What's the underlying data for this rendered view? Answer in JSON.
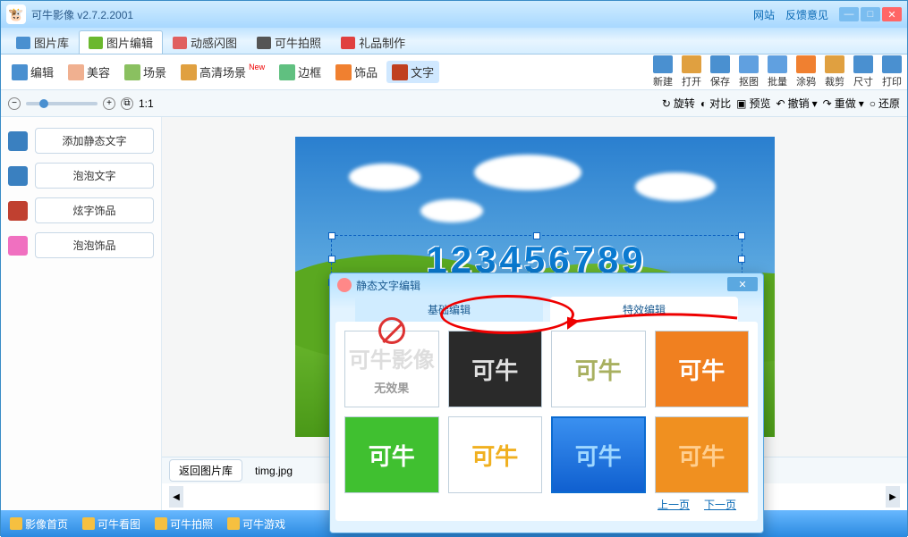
{
  "titlebar": {
    "title": "可牛影像  v2.7.2.2001",
    "link1": "网站",
    "link2": "反馈意见"
  },
  "maintabs": [
    {
      "label": "图片库",
      "color": "#4a90d0"
    },
    {
      "label": "图片编辑",
      "color": "#6bb82e",
      "active": true
    },
    {
      "label": "动感闪图",
      "color": "#e06060"
    },
    {
      "label": "可牛拍照",
      "color": "#555"
    },
    {
      "label": "礼品制作",
      "color": "#e04040"
    }
  ],
  "toolbar": [
    {
      "label": "编辑",
      "ic": "#4a90d0"
    },
    {
      "label": "美容",
      "ic": "#f0b090"
    },
    {
      "label": "场景",
      "ic": "#8ac060"
    },
    {
      "label": "高清场景",
      "ic": "#e0a040",
      "badge": true
    },
    {
      "label": "边框",
      "ic": "#60c080"
    },
    {
      "label": "饰品",
      "ic": "#f08030"
    },
    {
      "label": "文字",
      "ic": "#c04020",
      "active": true
    }
  ],
  "righttools": [
    {
      "label": "新建"
    },
    {
      "label": "打开"
    },
    {
      "label": "保存"
    },
    {
      "label": "抠图"
    },
    {
      "label": "批量"
    },
    {
      "label": "涂鸦"
    },
    {
      "label": "裁剪"
    },
    {
      "label": "尺寸"
    },
    {
      "label": "打印"
    }
  ],
  "subbar": {
    "ratio": "1:1",
    "rotate": "旋转",
    "compare": "对比",
    "preview": "预览",
    "undo": "撤销",
    "redo": "重做",
    "restore": "还原"
  },
  "leftpane": [
    {
      "label": "添加静态文字",
      "ic": "#3a80c0"
    },
    {
      "label": "泡泡文字",
      "ic": "#3a80c0"
    },
    {
      "label": "炫字饰品",
      "ic": "#c04030"
    },
    {
      "label": "泡泡饰品",
      "ic": "#f070c0"
    }
  ],
  "canvas": {
    "text": "123456789"
  },
  "bottombar": {
    "back": "返回图片库",
    "filename": "timg.jpg"
  },
  "footer": [
    {
      "label": "影像首页"
    },
    {
      "label": "可牛看图"
    },
    {
      "label": "可牛拍照"
    },
    {
      "label": "可牛游戏"
    }
  ],
  "dialog": {
    "title": "静态文字编辑",
    "tabs": [
      {
        "label": "基础编辑"
      },
      {
        "label": "特效编辑",
        "active": true
      }
    ],
    "noeffect": "无效果",
    "sample": "可牛",
    "effects": [
      {
        "bg": "#ffffff",
        "color": "#b0b4b8",
        "no": true
      },
      {
        "bg": "#2a2a2a",
        "color": "#e0e0e0"
      },
      {
        "bg": "#ffffff",
        "color": "#a8b060"
      },
      {
        "bg": "#f08020",
        "color": "#ffffff"
      },
      {
        "bg": "#40c030",
        "color": "#ffffff"
      },
      {
        "bg": "#ffffff",
        "color": "#f0b020"
      },
      {
        "bg": "linear-gradient(to bottom,#3a90f0,#1060d0)",
        "color": "#a0d8ff",
        "sel": true
      },
      {
        "bg": "#f09020",
        "color": "#ffcf90"
      }
    ],
    "prev": "上一页",
    "next": "下一页"
  }
}
